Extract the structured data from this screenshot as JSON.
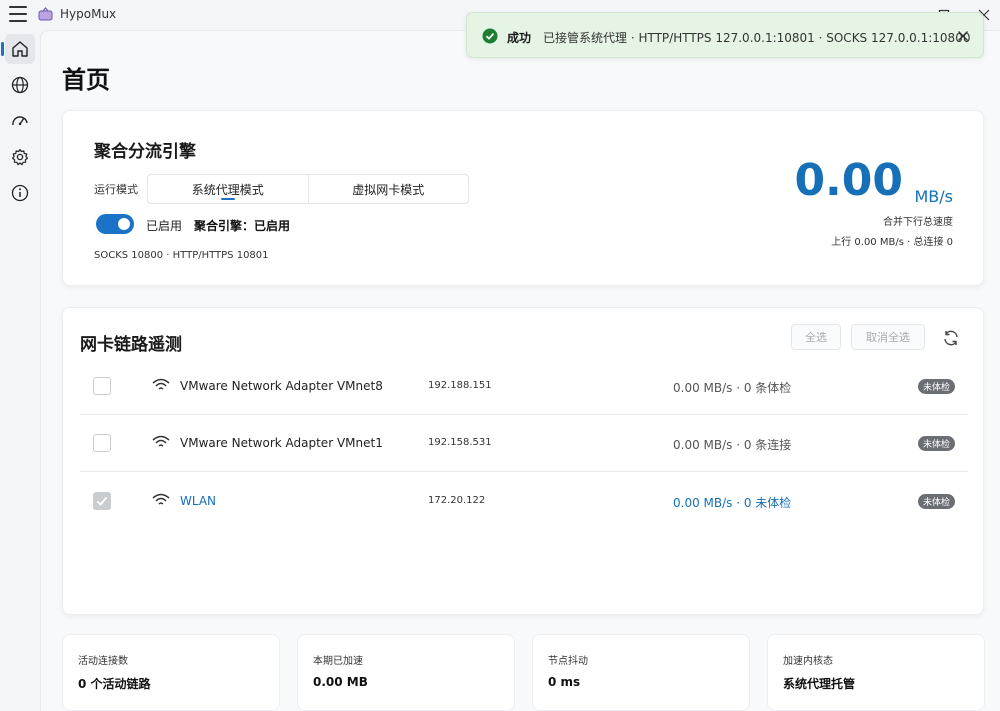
{
  "window": {
    "title": "HypoMux"
  },
  "page": {
    "title": "首页"
  },
  "toast": {
    "title": "成功",
    "message": "已接管系统代理 · HTTP/HTTPS 127.0.0.1:10801 · SOCKS 127.0.0.1:10800"
  },
  "engine": {
    "title": "聚合分流引擎",
    "mode_label": "运行模式",
    "modes": [
      {
        "label": "系统代理模式",
        "active": true
      },
      {
        "label": "虚拟网卡模式",
        "active": false
      }
    ],
    "toggle_on": true,
    "toggle_label": "已启用",
    "status": "聚合引擎：已启用",
    "ports": "SOCKS 10800 · HTTP/HTTPS 10801",
    "speed_value": "0.00",
    "speed_unit": "MB/s",
    "speed_caption": "合并下行总速度",
    "speed_sub": "上行 0.00 MB/s · 总连接 0"
  },
  "nic": {
    "title": "网卡链路遥测",
    "select_all": "全选",
    "cancel_all": "取消全选",
    "rows": [
      {
        "name": "VMware Network Adapter VMnet8",
        "ip": "192.188.151",
        "stat": "0.00 MB/s · 0 条体检",
        "badge": "未体检",
        "checked": false
      },
      {
        "name": "VMware Network Adapter VMnet1",
        "ip": "192.158.531",
        "stat": "0.00 MB/s · 0 条连接",
        "badge": "未体检",
        "checked": false
      },
      {
        "name": "WLAN",
        "ip": "172.20.122",
        "stat": "0.00 MB/s · 0 未体检",
        "badge": "未体检",
        "checked": true
      }
    ]
  },
  "stats": [
    {
      "label": "活动连接数",
      "value": "0 个活动链路"
    },
    {
      "label": "本期已加速",
      "value": "0.00 MB"
    },
    {
      "label": "节点抖动",
      "value": "0 ms"
    },
    {
      "label": "加速内核态",
      "value": "系统代理托管"
    }
  ],
  "colors": {
    "accent": "#1670b8",
    "toast_bg": "#e6f4e5",
    "success": "#1e7f34"
  },
  "icons": [
    "menu-icon",
    "app-logo-icon",
    "home-icon",
    "globe-icon",
    "speedometer-icon",
    "gear-icon",
    "info-icon",
    "check-circle-icon",
    "close-icon",
    "wifi-icon",
    "refresh-icon"
  ]
}
